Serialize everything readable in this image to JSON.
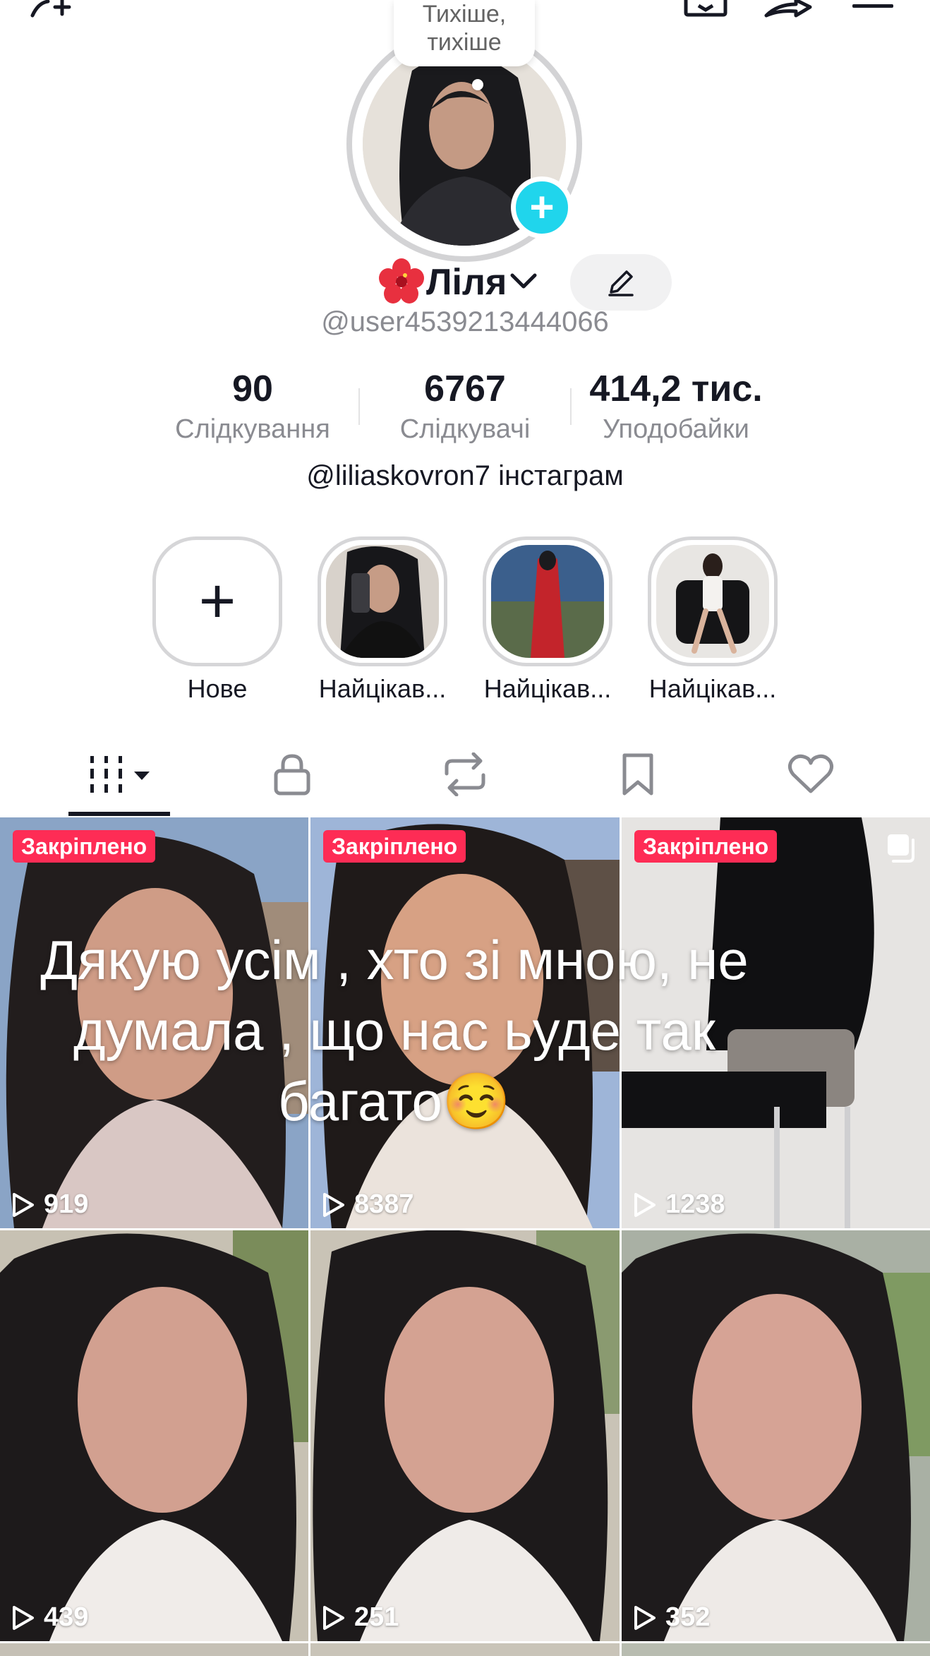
{
  "bubble": {
    "line1": "Тихіше,",
    "line2": "тихіше"
  },
  "profile": {
    "name_emoji": "🌺",
    "name": "Ліля",
    "username": "@user4539213444066",
    "bio": "@liliaskovron7 інстаграм"
  },
  "stats": [
    {
      "value": "90",
      "label": "Слідкування"
    },
    {
      "value": "6767",
      "label": "Слідкувачі"
    },
    {
      "value": "414,2 тис.",
      "label": "Уподобайки"
    }
  ],
  "highlights": [
    {
      "label": "Нове"
    },
    {
      "label": "Найцікав..."
    },
    {
      "label": "Найцікав..."
    },
    {
      "label": "Найцікав..."
    }
  ],
  "tabs": [
    {
      "icon": "grid-icon",
      "active": true
    },
    {
      "icon": "lock-icon"
    },
    {
      "icon": "repost-icon"
    },
    {
      "icon": "bookmark-icon"
    },
    {
      "icon": "heart-icon"
    }
  ],
  "videos": [
    {
      "views": "919",
      "pinned": "Закріплено"
    },
    {
      "views": "8387",
      "pinned": "Закріплено"
    },
    {
      "views": "1238",
      "pinned": "Закріплено"
    },
    {
      "views": "439"
    },
    {
      "views": "251"
    },
    {
      "views": "352"
    }
  ],
  "caption_overlay": {
    "line1": "Дякую усім , хто зі мною, не",
    "line2": "думала , що нас ьуде так",
    "line3": "багато☺️"
  },
  "colors": {
    "accent_blue": "#20d5ec",
    "pinned_red": "#fe2c55",
    "text": "#161823",
    "muted": "#8a8b91"
  }
}
